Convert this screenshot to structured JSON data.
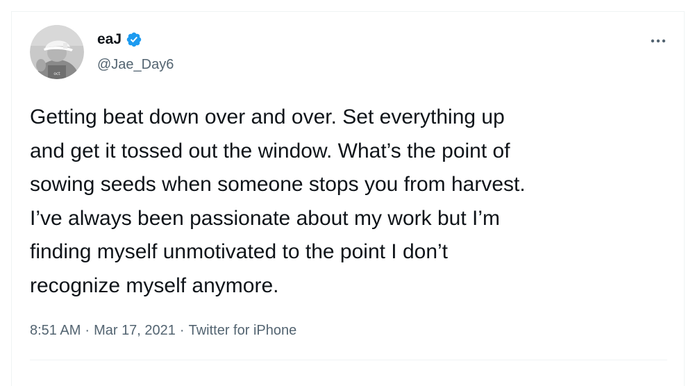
{
  "author": {
    "display_name": "eaJ",
    "handle": "@Jae_Day6",
    "verified": true,
    "avatar_icon": "avatar-person-in-white-cap"
  },
  "tweet": {
    "text": "Getting beat down over and over. Set everything up\nand get it tossed out the window. What’s the point of\nsowing seeds when someone stops you from harvest.\nI’ve always been passionate about my work but I’m\nfinding myself unmotivated to the point I don’t\nrecognize myself anymore.",
    "time": "8:51 AM",
    "separator_1": "·",
    "date": "Mar 17, 2021",
    "separator_2": "·",
    "source": "Twitter for iPhone"
  },
  "icons": {
    "verified": "verified-badge-icon",
    "more": "more-horizontal-icon"
  },
  "colors": {
    "verified_blue": "#1d9bf0",
    "text_primary": "#0f1419",
    "text_secondary": "#536471",
    "divider": "#eff3f4"
  }
}
